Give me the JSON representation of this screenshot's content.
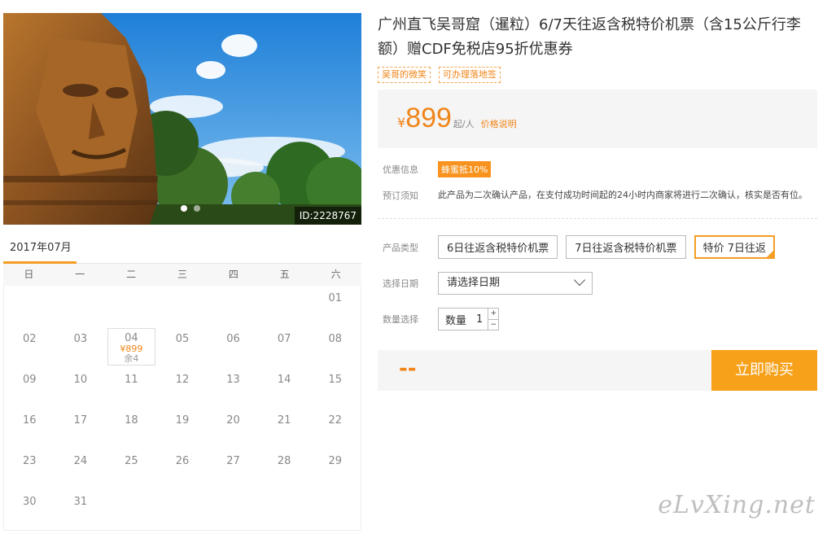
{
  "photo": {
    "id_label": "ID:2228767",
    "slides": 2,
    "active_slide": 0
  },
  "calendar": {
    "month": "2017年07月",
    "weekdays": [
      "日",
      "一",
      "二",
      "三",
      "四",
      "五",
      "六"
    ],
    "leading_blanks": 6,
    "days": [
      "01",
      "02",
      "03",
      "04",
      "05",
      "06",
      "07",
      "08",
      "09",
      "10",
      "11",
      "12",
      "13",
      "14",
      "15",
      "16",
      "17",
      "18",
      "19",
      "20",
      "21",
      "22",
      "23",
      "24",
      "25",
      "26",
      "27",
      "28",
      "29",
      "30",
      "31"
    ],
    "available": {
      "day": "04",
      "price": "¥899",
      "remain": "余4"
    }
  },
  "product": {
    "title": "广州直飞吴哥窟（暹粒）6/7天往返含税特价机票（含15公斤行李额）赠CDF免税店95折优惠券",
    "tags": [
      "吴哥的微笑",
      "可办理落地签"
    ],
    "price": {
      "currency": "¥",
      "amount": "899",
      "unit": "起/人",
      "explain": "价格说明"
    },
    "discount": {
      "label": "优惠信息",
      "badge": "蜂蜜抵10%"
    },
    "notice": {
      "label": "预订须知",
      "text": "此产品为二次确认产品，在支付成功时间起的24小时内商家将进行二次确认，核实是否有位。"
    },
    "type": {
      "label": "产品类型",
      "options": [
        "6日往返含税特价机票",
        "7日往返含税特价机票",
        "特价 7日往返"
      ],
      "selected": 2
    },
    "date": {
      "label": "选择日期",
      "value": "请选择日期"
    },
    "quantity": {
      "label": "数量选择",
      "inner_label": "数量",
      "value": "1",
      "plus": "+",
      "minus": "−"
    },
    "buy": {
      "total": "--",
      "button": "立即购买"
    }
  },
  "watermark": "eLvXing.net",
  "colors": {
    "accent": "#f08519",
    "button": "#f7a11a"
  }
}
